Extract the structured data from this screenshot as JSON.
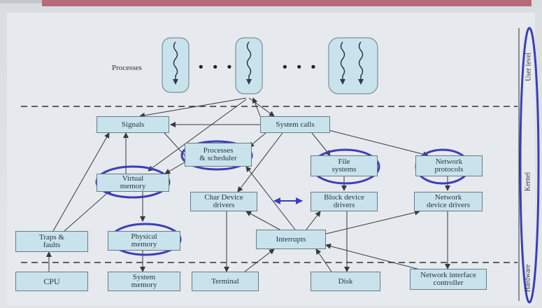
{
  "labels": {
    "processes": "Processes",
    "ellipsis1": "• • •",
    "ellipsis2": "• • •"
  },
  "boxes": {
    "signals": "Signals",
    "system_calls": "System calls",
    "processes_scheduler": "Processes\n& scheduler",
    "file_systems": "File\nsystems",
    "network_protocols": "Network\nprotocols",
    "virtual_memory": "Virtual\nmemory",
    "char_device_drivers": "Char Device\ndrivers",
    "block_device_drivers": "Block device\ndrivers",
    "network_device_drivers": "Network\ndevice drivers",
    "traps_faults": "Traps &\nfaults",
    "physical_memory": "Physical\nmemory",
    "interrupts": "Interrupts",
    "cpu": "CPU",
    "system_memory": "System\nmemory",
    "terminal": "Terminal",
    "disk": "Disk",
    "network_interface_controller": "Network interface\ncontroller"
  },
  "side_labels": {
    "user_level": "User level",
    "kernel": "Kernel",
    "hardware": "Hardware"
  },
  "colors": {
    "box_fill": "#c8e3ec",
    "highlight_circle": "#3b3fb8",
    "arrow": "#333a44"
  }
}
